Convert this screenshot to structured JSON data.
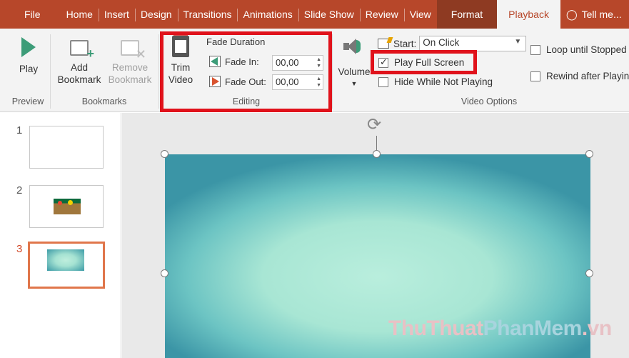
{
  "tabs": [
    {
      "label": "File"
    },
    {
      "label": "Home"
    },
    {
      "label": "Insert"
    },
    {
      "label": "Design"
    },
    {
      "label": "Transitions"
    },
    {
      "label": "Animations"
    },
    {
      "label": "Slide Show"
    },
    {
      "label": "Review"
    },
    {
      "label": "View"
    },
    {
      "label": "Format"
    },
    {
      "label": "Playback"
    },
    {
      "label": "Tell me..."
    }
  ],
  "colors": {
    "accent": "#b7472a",
    "active_tab_text": "#b7472a",
    "highlight_box": "#e0121b"
  },
  "ribbon": {
    "preview": {
      "play_label": "Play",
      "group_label": "Preview"
    },
    "bookmarks": {
      "add_line1": "Add",
      "add_line2": "Bookmark",
      "remove_line1": "Remove",
      "remove_line2": "Bookmark",
      "group_label": "Bookmarks"
    },
    "editing": {
      "trim_line1": "Trim",
      "trim_line2": "Video",
      "fade_title": "Fade Duration",
      "fade_in_label": "Fade In:",
      "fade_in_value": "00,00",
      "fade_out_label": "Fade Out:",
      "fade_out_value": "00,00",
      "group_label": "Editing"
    },
    "volume": {
      "label": "Volume"
    },
    "video_options": {
      "start_label": "Start:",
      "start_value": "On Click",
      "play_full_screen": {
        "label": "Play Full Screen",
        "checked": true
      },
      "hide_while_not_playing": {
        "label": "Hide While Not Playing",
        "checked": false
      },
      "loop_until_stopped": {
        "label": "Loop until Stopped",
        "checked": false
      },
      "rewind_after_playing": {
        "label": "Rewind after Playing",
        "checked": false
      },
      "group_label": "Video Options"
    }
  },
  "slides": [
    {
      "number": "1"
    },
    {
      "number": "2"
    },
    {
      "number": "3"
    }
  ],
  "watermark": {
    "part1": "ThuThuat",
    "part2": "PhanMem",
    "part3": ".vn"
  }
}
